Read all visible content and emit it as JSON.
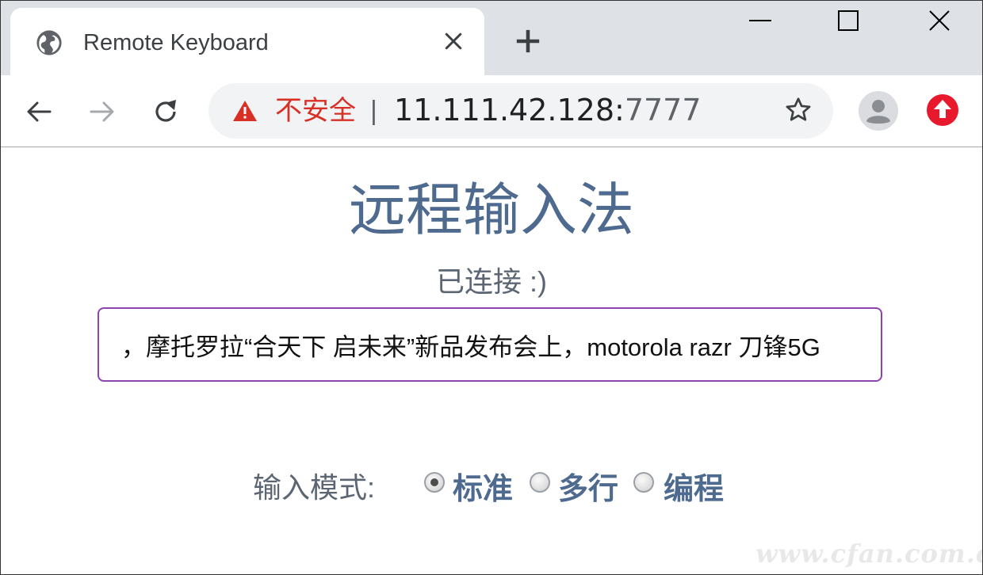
{
  "browser": {
    "tab": {
      "title": "Remote Keyboard",
      "icon": "globe-icon"
    },
    "address_bar": {
      "security_label": "不安全",
      "separator": "|",
      "host": "11.111.42.128:",
      "port": "7777"
    },
    "colors": {
      "warning": "#d93025",
      "extension": "#e8192c"
    }
  },
  "page": {
    "title": "远程输入法",
    "status": "已连接 :)",
    "input_value": "，摩托罗拉“合天下 启未来”新品发布会上，motorola razr 刀锋5G",
    "mode_label": "输入模式:",
    "modes": [
      {
        "label": "标准",
        "checked": true
      },
      {
        "label": "多行",
        "checked": false
      },
      {
        "label": "编程",
        "checked": false
      }
    ],
    "accent_color": "#4e6b8f",
    "input_border_color": "#8e44ad"
  },
  "watermark": "www.cfan.com.cn"
}
